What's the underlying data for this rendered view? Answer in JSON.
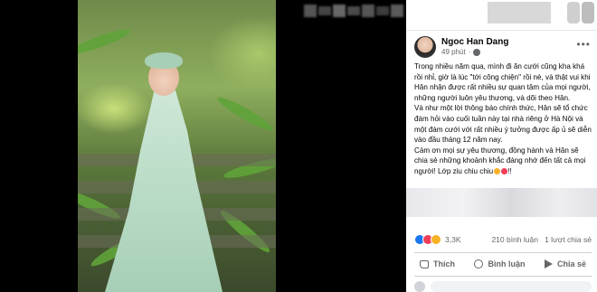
{
  "post": {
    "author": "Ngoc Han Dang",
    "time": "49 phút",
    "paragraphs": [
      "Trong nhiều năm qua, mình đi ăn cưới cũng kha khá rồi nhỉ, giờ là lúc \"tới công chiện\" rồi nè, và thật vui khi Hân nhận được rất nhiều sự quan tâm của mọi người, những người luôn yêu thương, và dõi theo Hân.",
      "Và như một lời thông báo chính thức, Hân sẽ tổ chức đám hỏi vào cuối tuần này tại nhà riêng ở Hà Nội và một đám cưới với rất nhiều ý tưởng được ấp ủ sẽ diễn vào đầu tháng 12 năm nay.",
      "Cảm ơn mọi sự yêu thương, đồng hành và Hân sẽ chia sẻ những khoảnh khắc đáng nhớ đến tất cả mọi người! Lớp ziu chiu chiu",
      "!!"
    ]
  },
  "stats": {
    "reactions": "3,3K",
    "comments": "210 bình luận",
    "shares": "1 lượt chia sẻ"
  },
  "actions": {
    "like": "Thích",
    "comment": "Bình luận",
    "share": "Chia sẻ"
  },
  "icons": {
    "more": "more-options-icon",
    "globe": "globe-icon",
    "like": "like-icon",
    "comment": "comment-icon",
    "share": "share-icon"
  },
  "colors": {
    "brand_blue": "#1877f2",
    "love_red": "#f33e58",
    "care_yellow": "#f7b125",
    "muted_text": "#65676b"
  }
}
